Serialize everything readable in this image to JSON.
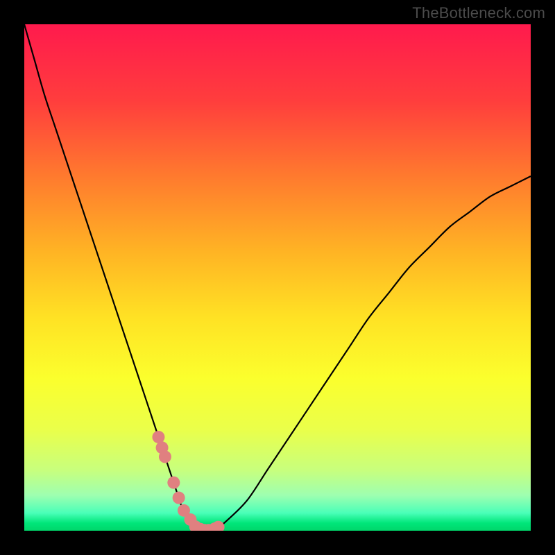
{
  "watermark": "TheBottleneck.com",
  "chart_data": {
    "type": "line",
    "title": "",
    "xlabel": "",
    "ylabel": "",
    "xlim": [
      0,
      100
    ],
    "ylim": [
      0,
      100
    ],
    "x": [
      0,
      2,
      4,
      6,
      8,
      10,
      12,
      14,
      16,
      18,
      20,
      22,
      24,
      26,
      27,
      28,
      29,
      30,
      31,
      32,
      33,
      34,
      36,
      38,
      40,
      44,
      48,
      52,
      56,
      60,
      64,
      68,
      72,
      76,
      80,
      84,
      88,
      92,
      96,
      100
    ],
    "values": [
      100,
      93,
      86,
      80,
      74,
      68,
      62,
      56,
      50,
      44,
      38,
      32,
      26,
      20,
      17,
      14,
      11,
      8,
      5,
      3,
      2,
      0.5,
      0,
      0.5,
      2,
      6,
      12,
      18,
      24,
      30,
      36,
      42,
      47,
      52,
      56,
      60,
      63,
      66,
      68,
      70
    ],
    "gradient_stops": [
      {
        "offset": 0.0,
        "color": "#ff1a4d"
      },
      {
        "offset": 0.15,
        "color": "#ff3d3d"
      },
      {
        "offset": 0.3,
        "color": "#ff7a2e"
      },
      {
        "offset": 0.45,
        "color": "#ffb424"
      },
      {
        "offset": 0.58,
        "color": "#ffe224"
      },
      {
        "offset": 0.7,
        "color": "#fbff2d"
      },
      {
        "offset": 0.8,
        "color": "#eaff4a"
      },
      {
        "offset": 0.88,
        "color": "#c8ff7d"
      },
      {
        "offset": 0.93,
        "color": "#9effb0"
      },
      {
        "offset": 0.965,
        "color": "#4affb8"
      },
      {
        "offset": 0.985,
        "color": "#00e67a"
      },
      {
        "offset": 1.0,
        "color": "#00d66a"
      }
    ],
    "marker_points_x": [
      26.5,
      27.2,
      27.8,
      29.5,
      30.5,
      31.5,
      32.8,
      33.8,
      34.8,
      35.6,
      36.4,
      37.6,
      38.3
    ],
    "marker_color": "#e08080",
    "curve_color": "#000000"
  }
}
